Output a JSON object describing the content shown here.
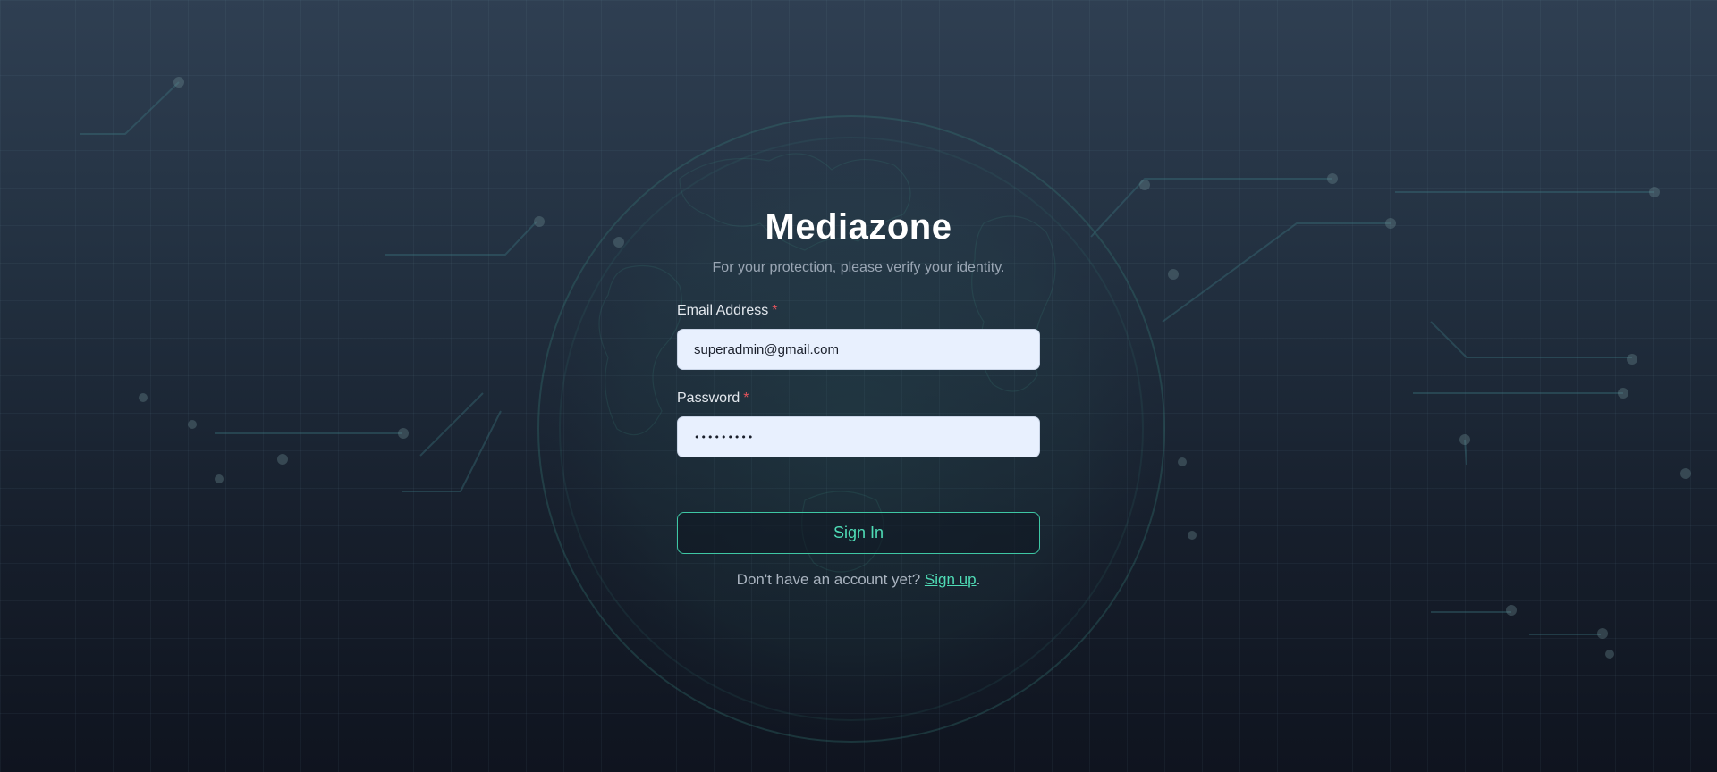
{
  "brand": {
    "title": "Mediazone",
    "subtitle": "For your protection, please verify your identity."
  },
  "form": {
    "email": {
      "label": "Email Address",
      "required_marker": "*",
      "value": "superadmin@gmail.com"
    },
    "password": {
      "label": "Password",
      "required_marker": "*",
      "value": "•••••••••"
    },
    "submit_label": "Sign In"
  },
  "signup": {
    "prompt": "Don't have an account yet?",
    "link_text": "Sign up",
    "suffix": "."
  },
  "colors": {
    "accent": "#4fdcb6",
    "required": "#e2545c",
    "input_bg": "#e8f0fe",
    "background_top": "#2f3f52",
    "background_bottom": "#0f141f"
  }
}
